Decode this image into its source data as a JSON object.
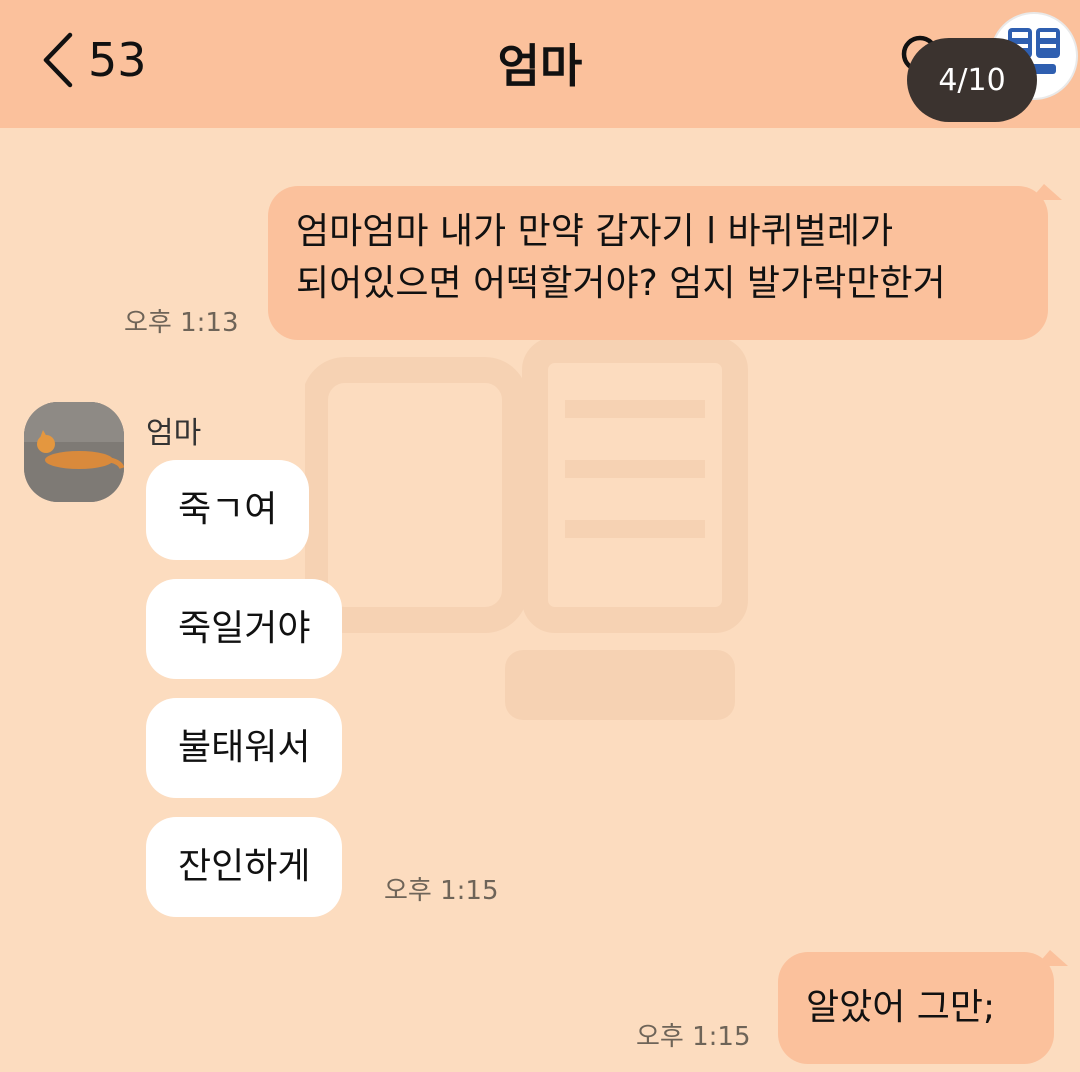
{
  "header": {
    "back_count": "53",
    "title": "엄마",
    "page_counter": "4/10"
  },
  "messages": [
    {
      "from": "me",
      "lines": [
        "엄마엄마 내가 만약 갑자기 l  바퀴벌레가",
        "되어있으면 어떡할거야? 엄지 발가락만한거"
      ],
      "time": "오후 1:13"
    },
    {
      "from": "them",
      "sender": "엄마",
      "texts": [
        "죽ㄱ여",
        "죽일거야",
        "불태워서",
        "잔인하게"
      ],
      "time": "오후 1:15"
    },
    {
      "from": "me",
      "lines": [
        "알았어 그만;"
      ],
      "time": "오후 1:15"
    }
  ],
  "colors": {
    "background": "#FCDCBF",
    "header": "#FBC19C",
    "my_bubble": "#FBC19C",
    "their_bubble": "#FFFFFF",
    "counter_pill": "#3B332F"
  },
  "icons": {
    "back": "chevron-left-icon",
    "search": "search-icon",
    "logo": "watermark-logo-icon"
  }
}
